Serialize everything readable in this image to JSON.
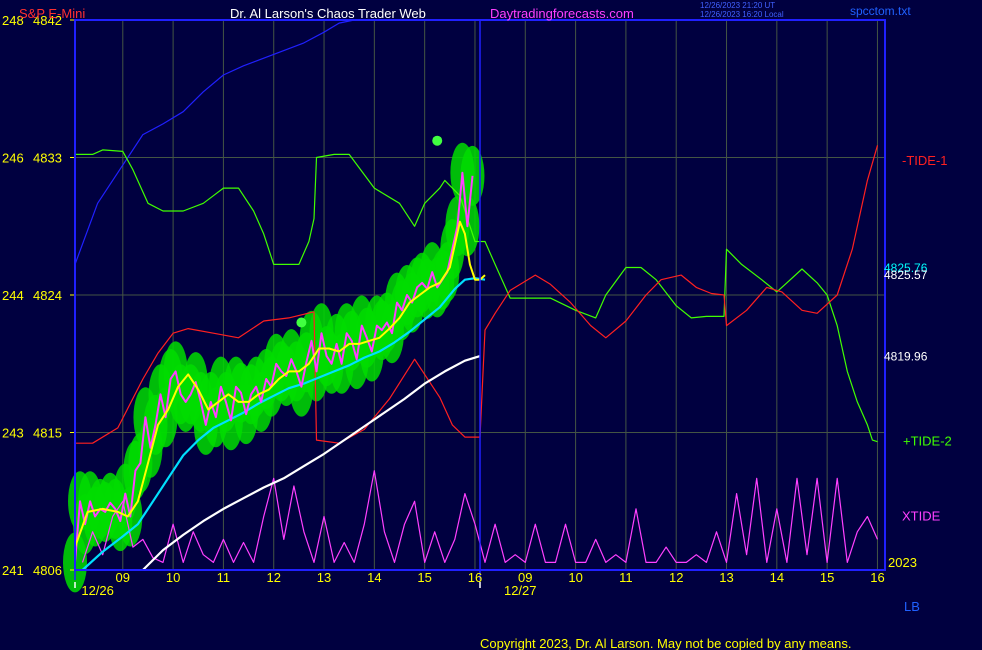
{
  "header": {
    "instrument": "S&P E-Mini",
    "title": "Dr. Al Larson's Chaos Trader Web",
    "site": "Daytradingforecasts.com",
    "timestamp_line1": "12/26/2023 21:20 UT",
    "timestamp_line2": "12/26/2023 16:20 Local",
    "file": "spcctom.txt"
  },
  "footer": {
    "copyright": "Copyright 2023, Dr. Al Larson. May not be copied by any means.",
    "corner_label": "LB"
  },
  "colors": {
    "background": "#000040",
    "frame": "#2020ff",
    "grid": "#445544",
    "price": "#ff40ff",
    "average": "#ffff00",
    "ma_cyan": "#00e0ff",
    "ma_white": "#ffffff",
    "ma_blue": "#2020ff",
    "tide_plus": "#40ff00",
    "tide_minus": "#ff2020",
    "xtide": "#ff40ff",
    "bands": "#00dd00"
  },
  "chart_data": {
    "type": "line",
    "title": "Dr. Al Larson's Chaos Trader Web",
    "ylim": [
      4806,
      4842
    ],
    "y_ticks": [
      {
        "left": "241",
        "value": 4806,
        "label": "4806"
      },
      {
        "left": "243",
        "value": 4815,
        "label": "4815"
      },
      {
        "left": "244",
        "value": 4824,
        "label": "4824"
      },
      {
        "left": "246",
        "value": 4833,
        "label": "4833"
      },
      {
        "left": "248",
        "value": 4842,
        "label": "4842"
      }
    ],
    "x_ticks": [
      {
        "t": 9,
        "label": "09"
      },
      {
        "t": 10,
        "label": "10"
      },
      {
        "t": 11,
        "label": "11"
      },
      {
        "t": 12,
        "label": "12"
      },
      {
        "t": 13,
        "label": "13"
      },
      {
        "t": 14,
        "label": "14"
      },
      {
        "t": 15,
        "label": "15"
      },
      {
        "t": 16,
        "label": "16"
      },
      {
        "t": 17,
        "label": "09"
      },
      {
        "t": 18,
        "label": "10"
      },
      {
        "t": 19,
        "label": "11"
      },
      {
        "t": 20,
        "label": "12"
      },
      {
        "t": 21,
        "label": "13"
      },
      {
        "t": 22,
        "label": "14"
      },
      {
        "t": 23,
        "label": "15"
      },
      {
        "t": 24,
        "label": "16"
      }
    ],
    "xlim": [
      8.05,
      24.15
    ],
    "dates": [
      {
        "t": 8.5,
        "label": "12/26"
      },
      {
        "t": 16.9,
        "label": "12/27"
      }
    ],
    "year_label": "2023",
    "right_values": [
      {
        "value": 4825.76,
        "label": "4825.76"
      },
      {
        "value": 4825.57,
        "label": "4825.57"
      },
      {
        "value": 4819.96,
        "label": "4819.96"
      }
    ],
    "series": [
      {
        "name": "-TIDE-1",
        "x": [
          8.05,
          8.4,
          8.9,
          9.4,
          9.7,
          10.0,
          10.3,
          10.8,
          11.3,
          11.8,
          12.3,
          12.8,
          12.85,
          13.3,
          13.8,
          14.3,
          14.8,
          15.3,
          15.55,
          15.8,
          16.1,
          16.2,
          16.4,
          16.7,
          17.2,
          17.5,
          17.9,
          18.3,
          18.6,
          19.0,
          19.4,
          19.7,
          20.1,
          20.4,
          20.7,
          20.95,
          21.0,
          21.4,
          21.8,
          22.1,
          22.5,
          22.8,
          23.2,
          23.5,
          23.8,
          24.0
        ],
        "y": [
          4814.3,
          4814.3,
          4815.3,
          4818.5,
          4820.2,
          4821.5,
          4821.8,
          4821.5,
          4821.2,
          4822.3,
          4822.5,
          4822.9,
          4814.5,
          4814.3,
          4815.2,
          4817.2,
          4819.8,
          4817.3,
          4815.5,
          4814.7,
          4814.7,
          4821.7,
          4822.8,
          4824.3,
          4825.3,
          4824.7,
          4823.5,
          4822.0,
          4821.2,
          4822.3,
          4824.0,
          4825.0,
          4825.3,
          4824.5,
          4824.1,
          4824.0,
          4822.0,
          4823.0,
          4824.5,
          4824.2,
          4823.0,
          4822.8,
          4824.0,
          4827.0,
          4831.5,
          4833.8
        ]
      },
      {
        "name": "+TIDE-2",
        "x": [
          8.05,
          8.4,
          8.6,
          9.0,
          9.2,
          9.5,
          9.8,
          10.2,
          10.6,
          10.8,
          11.0,
          11.3,
          11.6,
          11.8,
          12.0,
          12.5,
          12.7,
          12.8,
          12.85,
          13.2,
          13.5,
          14.0,
          14.5,
          14.8,
          15.0,
          15.3,
          15.4,
          15.7,
          16.0,
          16.2,
          16.4,
          16.7,
          17.2,
          17.5,
          18.0,
          18.4,
          18.6,
          19.0,
          19.3,
          19.6,
          20.0,
          20.3,
          20.6,
          20.95,
          21.0,
          21.3,
          21.7,
          22.0,
          22.2,
          22.5,
          22.8,
          23.0,
          23.2,
          23.4,
          23.6,
          23.8,
          23.9,
          24.0
        ],
        "y": [
          4833.2,
          4833.2,
          4833.5,
          4833.4,
          4832.2,
          4830.0,
          4829.5,
          4829.5,
          4830.0,
          4830.5,
          4831.0,
          4831.0,
          4829.5,
          4828.0,
          4826.0,
          4826.0,
          4827.5,
          4829.0,
          4833.0,
          4833.2,
          4833.2,
          4831.0,
          4830.0,
          4828.5,
          4830.0,
          4831.0,
          4831.5,
          4830.5,
          4827.5,
          4827.5,
          4826.0,
          4823.8,
          4823.8,
          4823.8,
          4823.0,
          4822.5,
          4824.0,
          4825.8,
          4825.8,
          4825.0,
          4823.3,
          4822.5,
          4822.6,
          4822.6,
          4827.0,
          4826.0,
          4825.0,
          4824.2,
          4824.8,
          4825.7,
          4824.8,
          4824.0,
          4822.0,
          4819.0,
          4817.0,
          4815.5,
          4814.5,
          4814.4
        ]
      },
      {
        "name": "XTIDE",
        "x": [
          8.2,
          8.4,
          8.6,
          8.8,
          9.0,
          9.2,
          9.4,
          9.6,
          9.8,
          10.0,
          10.2,
          10.4,
          10.6,
          10.8,
          11.0,
          11.2,
          11.4,
          11.6,
          11.8,
          12.0,
          12.2,
          12.4,
          12.6,
          12.8,
          13.0,
          13.2,
          13.4,
          13.6,
          13.8,
          14.0,
          14.2,
          14.4,
          14.6,
          14.8,
          15.0,
          15.2,
          15.4,
          15.6,
          15.8,
          16.0,
          16.2,
          16.4,
          16.6,
          16.8,
          17.0,
          17.2,
          17.4,
          17.6,
          17.8,
          18.0,
          18.2,
          18.4,
          18.6,
          18.8,
          19.0,
          19.2,
          19.4,
          19.6,
          19.8,
          20.0,
          20.2,
          20.4,
          20.6,
          20.8,
          21.0,
          21.2,
          21.4,
          21.6,
          21.8,
          22.0,
          22.2,
          22.4,
          22.6,
          22.8,
          23.0,
          23.2,
          23.4,
          23.6,
          23.8,
          24.0
        ],
        "y": [
          4806.5,
          4808.5,
          4807.0,
          4809.5,
          4810.5,
          4807.5,
          4808.0,
          4806.8,
          4806.5,
          4809.0,
          4806.5,
          4808.5,
          4807.0,
          4806.5,
          4808.0,
          4806.5,
          4807.8,
          4806.5,
          4809.5,
          4812.0,
          4808.0,
          4811.5,
          4808.5,
          4806.5,
          4809.5,
          4806.5,
          4807.8,
          4806.5,
          4809.0,
          4812.5,
          4808.5,
          4806.5,
          4809.0,
          4810.5,
          4806.5,
          4808.5,
          4806.5,
          4808.0,
          4811.0,
          4809.0,
          4806.5,
          4809.0,
          4806.5,
          4807.0,
          4806.5,
          4809.0,
          4806.5,
          4806.5,
          4809.0,
          4806.5,
          4806.5,
          4808.0,
          4806.5,
          4807.0,
          4806.5,
          4810.0,
          4806.5,
          4806.5,
          4807.5,
          4806.5,
          4806.5,
          4807.0,
          4806.5,
          4808.5,
          4806.5,
          4811.0,
          4807.0,
          4812.0,
          4806.5,
          4810.0,
          4806.5,
          4812.0,
          4807.0,
          4812.0,
          4806.5,
          4812.0,
          4806.5,
          4808.5,
          4809.5,
          4808.0
        ]
      },
      {
        "name": "Price",
        "x": [
          8.05,
          8.15,
          8.25,
          8.35,
          8.45,
          8.55,
          8.65,
          8.75,
          8.85,
          8.95,
          9.05,
          9.15,
          9.25,
          9.35,
          9.45,
          9.55,
          9.65,
          9.75,
          9.85,
          9.95,
          10.05,
          10.15,
          10.25,
          10.35,
          10.45,
          10.55,
          10.65,
          10.75,
          10.85,
          10.95,
          11.05,
          11.15,
          11.25,
          11.35,
          11.45,
          11.55,
          11.65,
          11.75,
          11.85,
          11.95,
          12.05,
          12.15,
          12.25,
          12.35,
          12.45,
          12.55,
          12.65,
          12.75,
          12.85,
          12.95,
          13.05,
          13.15,
          13.25,
          13.35,
          13.45,
          13.55,
          13.65,
          13.75,
          13.85,
          13.95,
          14.05,
          14.15,
          14.25,
          14.35,
          14.45,
          14.55,
          14.65,
          14.75,
          14.85,
          14.95,
          15.05,
          15.15,
          15.25,
          15.35,
          15.45,
          15.55,
          15.65,
          15.75,
          15.85,
          15.95
        ],
        "y": [
          4806.5,
          4810.5,
          4809.0,
          4810.5,
          4809.5,
          4810.0,
          4809.8,
          4810.4,
          4810.0,
          4809.2,
          4811.0,
          4809.5,
          4812.5,
          4813.0,
          4816.0,
          4814.0,
          4815.5,
          4817.5,
          4816.0,
          4818.5,
          4819.0,
          4817.5,
          4817.0,
          4817.5,
          4818.3,
          4817.0,
          4815.5,
          4817.0,
          4816.0,
          4818.0,
          4817.0,
          4815.8,
          4818.0,
          4817.6,
          4816.2,
          4817.5,
          4818.0,
          4817.0,
          4818.5,
          4818.0,
          4819.5,
          4819.0,
          4818.7,
          4819.8,
          4819.0,
          4818.0,
          4819.6,
          4821.0,
          4819.0,
          4821.5,
          4820.0,
          4819.5,
          4820.8,
          4819.5,
          4821.5,
          4821.0,
          4819.8,
          4822.0,
          4821.2,
          4820.3,
          4822.0,
          4821.7,
          4822.2,
          4821.5,
          4823.5,
          4823.0,
          4824.0,
          4823.5,
          4824.5,
          4824.8,
          4824.4,
          4825.5,
          4824.5,
          4825.0,
          4825.5,
          4827.0,
          4828.5,
          4832.0,
          4828.5,
          4831.8
        ]
      },
      {
        "name": "Average",
        "x": [
          8.05,
          8.3,
          8.6,
          8.9,
          9.1,
          9.3,
          9.5,
          9.7,
          9.9,
          10.1,
          10.3,
          10.5,
          10.7,
          10.9,
          11.1,
          11.3,
          11.5,
          11.7,
          11.9,
          12.1,
          12.3,
          12.5,
          12.7,
          12.9,
          13.1,
          13.3,
          13.5,
          13.7,
          13.9,
          14.1,
          14.3,
          14.5,
          14.7,
          14.9,
          15.1,
          15.3,
          15.5,
          15.7,
          15.8,
          15.9,
          16.0,
          16.1,
          16.2
        ],
        "y": [
          4807.5,
          4809.8,
          4810.0,
          4809.8,
          4809.5,
          4810.5,
          4813.0,
          4815.5,
          4816.5,
          4818.0,
          4818.8,
          4817.8,
          4816.5,
          4817.0,
          4817.5,
          4817.0,
          4817.0,
          4817.5,
          4817.8,
          4818.5,
          4819.0,
          4819.0,
          4819.5,
          4820.5,
          4820.5,
          4820.3,
          4820.8,
          4820.8,
          4821.0,
          4821.2,
          4821.8,
          4822.5,
          4823.5,
          4824.0,
          4824.5,
          4824.8,
          4825.8,
          4828.8,
          4828.0,
          4826.0,
          4825.0,
          4825.0,
          4825.3
        ]
      },
      {
        "name": "MA-cyan",
        "x": [
          8.2,
          8.6,
          9.0,
          9.3,
          9.6,
          9.9,
          10.2,
          10.5,
          10.8,
          11.1,
          11.4,
          11.7,
          12.0,
          12.3,
          12.6,
          12.9,
          13.2,
          13.5,
          13.8,
          14.1,
          14.4,
          14.7,
          15.0,
          15.3,
          15.6,
          15.8,
          16.0,
          16.2
        ],
        "y": [
          4806.0,
          4807.2,
          4808.2,
          4809.0,
          4810.5,
          4812.0,
          4813.5,
          4814.5,
          4815.3,
          4815.8,
          4816.3,
          4816.9,
          4817.4,
          4817.9,
          4818.2,
          4818.6,
          4819.0,
          4819.4,
          4819.9,
          4820.3,
          4820.9,
          4821.6,
          4822.4,
          4823.2,
          4824.4,
          4825.0,
          4825.1,
          4825.0
        ]
      },
      {
        "name": "MA-white",
        "x": [
          9.4,
          9.8,
          10.2,
          10.6,
          11.0,
          11.4,
          11.8,
          12.2,
          12.6,
          13.0,
          13.4,
          13.8,
          14.2,
          14.6,
          15.0,
          15.4,
          15.8,
          16.1
        ],
        "y": [
          4806.0,
          4807.3,
          4808.3,
          4809.2,
          4810.0,
          4810.7,
          4811.4,
          4812.0,
          4812.8,
          4813.6,
          4814.5,
          4815.4,
          4816.3,
          4817.2,
          4818.2,
          4819.0,
          4819.7,
          4820.0
        ]
      },
      {
        "name": "MA-blue",
        "x": [
          8.05,
          8.5,
          9.0,
          9.4,
          9.8,
          10.2,
          10.6,
          11.0,
          11.4,
          11.8,
          12.2,
          12.6,
          13.0,
          13.3,
          13.6
        ],
        "y": [
          4826.0,
          4830.0,
          4832.5,
          4834.5,
          4835.2,
          4836.0,
          4837.3,
          4838.4,
          4839.0,
          4839.5,
          4840.0,
          4840.5,
          4841.2,
          4841.8,
          4842.0
        ]
      }
    ],
    "right_labels": [
      {
        "name": "-TIDE-1",
        "label": "-TIDE-1"
      },
      {
        "name": "+TIDE-2",
        "label": "+TIDE-2"
      },
      {
        "name": "XTIDE",
        "label": "XTIDE"
      }
    ],
    "markers": [
      {
        "t": 12.55,
        "value": 4822.2
      },
      {
        "t": 15.25,
        "value": 4834.1
      }
    ],
    "grid": true
  }
}
